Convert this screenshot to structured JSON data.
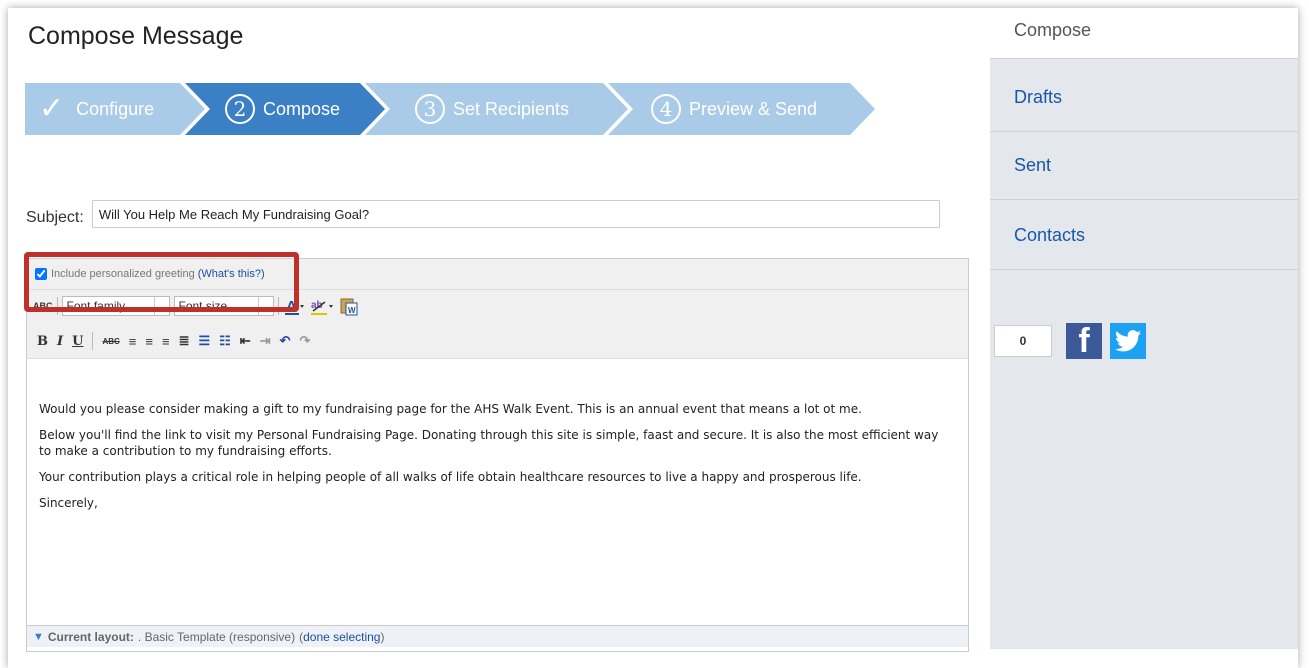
{
  "page_title": "Compose Message",
  "steps": [
    {
      "number": "✓",
      "label": "Configure"
    },
    {
      "number": "2",
      "label": "Compose"
    },
    {
      "number": "3",
      "label": "Set Recipients"
    },
    {
      "number": "4",
      "label": "Preview & Send"
    }
  ],
  "subject": {
    "label": "Subject:",
    "value": "Will You Help Me Reach My Fundraising Goal?"
  },
  "greeting": {
    "label": "Include personalized greeting",
    "link": "(What's this?)",
    "checked": true
  },
  "toolbar": {
    "font_family": "Font family",
    "font_size": "Font size",
    "spell_label": "ABC",
    "bold": "B",
    "italic": "I",
    "underline": "U",
    "strike": "ABC"
  },
  "message": {
    "paragraphs": [
      "Would you please consider making a gift to my fundraising page for the AHS Walk Event. This is an annual event that means a lot ot me.",
      "Below you'll find the link to visit my Personal Fundraising Page. Donating through this site is simple, faast and secure. It is also the most efficient way to make a contribution to my fundraising efforts.",
      "Your contribution plays a critical role in helping people of all walks of life obtain healthcare resources to live a happy and prosperous life.",
      "Sincerely,"
    ]
  },
  "layout_bar": {
    "label": "Current layout:",
    "value": ". Basic Template (responsive)",
    "link": "done selecting"
  },
  "sidebar": {
    "items": [
      {
        "label": "Compose",
        "active": true
      },
      {
        "label": "Drafts"
      },
      {
        "label": "Sent"
      },
      {
        "label": "Contacts"
      }
    ]
  },
  "share": {
    "count": "0"
  },
  "colors": {
    "step_active": "#3b7fc4",
    "step_inactive": "#a9cbe8",
    "highlight": "#c0302a",
    "link": "#1a56a8"
  }
}
